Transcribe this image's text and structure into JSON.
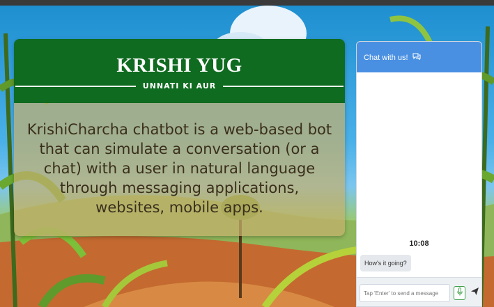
{
  "hero": {
    "title": "KRISHI YUG",
    "subtitle": "UNNATI KI AUR",
    "description": "KrishiCharcha chatbot is a web-based bot that can simulate a conversation (or a chat) with a user in natural language through messaging applications, websites, mobile apps."
  },
  "chat": {
    "header": "Chat with us!",
    "header_icon": "chat-bubbles-icon",
    "time": "10:08",
    "messages": [
      {
        "text": "How's it going?"
      }
    ],
    "input_placeholder": "Tap 'Enter' to send a message",
    "mic_icon": "microphone-icon",
    "send_icon": "send-icon"
  },
  "colors": {
    "hero_header": "#0f6b1f",
    "chat_header": "#4a90e2",
    "mic_border": "#3fa14a"
  }
}
